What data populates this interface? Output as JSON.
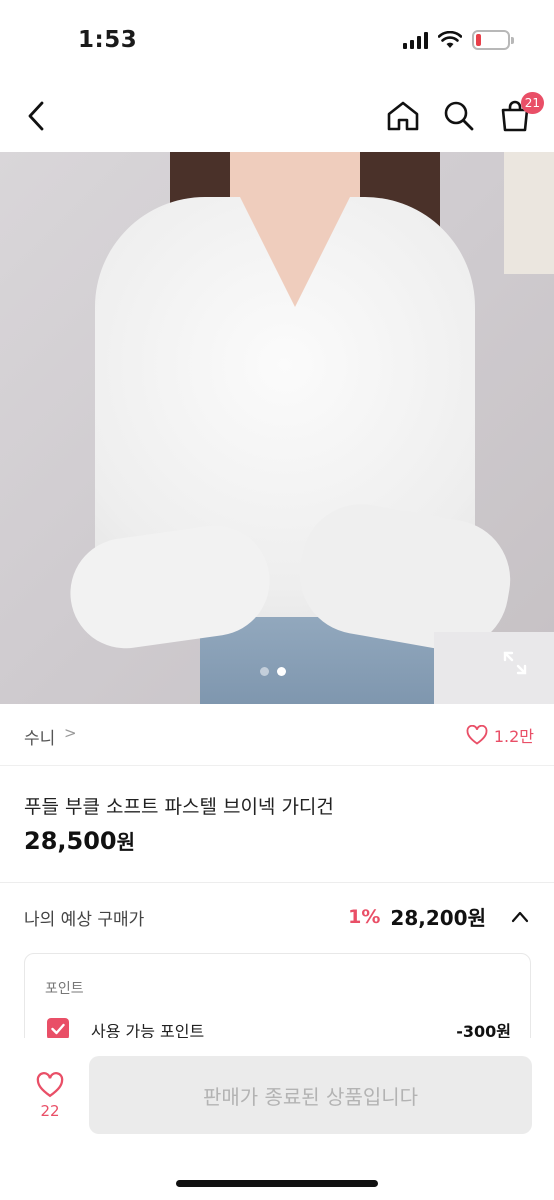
{
  "status_bar": {
    "time": "1:53",
    "battery_level": 0.15,
    "battery_color": "#e8404a"
  },
  "nav": {
    "back_icon": "chevron-left-icon",
    "home_icon": "home-icon",
    "search_icon": "search-icon",
    "cart_icon": "shopping-bag-icon",
    "cart_badge": "21"
  },
  "gallery": {
    "dots": [
      {
        "active": false
      },
      {
        "active": true
      }
    ],
    "expand_icon": "expand-icon"
  },
  "seller": {
    "name": "수니",
    "chevron": ">",
    "like_count": "1.2만"
  },
  "product": {
    "title": "푸들 부클 소프트 파스텔 브이넥 가디건",
    "price": "28,500",
    "currency": "원"
  },
  "expected_price": {
    "label": "나의 예상 구매가",
    "discount": "1%",
    "amount": "28,200원"
  },
  "points": {
    "heading": "포인트",
    "usable_label": "사용 가능 포인트",
    "usable_value": "-300원",
    "checked": true
  },
  "bottom_bar": {
    "like_count": "22",
    "cta_label": "판매가 종료된 상품입니다"
  },
  "colors": {
    "accent": "#e94f67",
    "disabled_bg": "#ebebeb",
    "disabled_text": "#b3b3b3"
  }
}
